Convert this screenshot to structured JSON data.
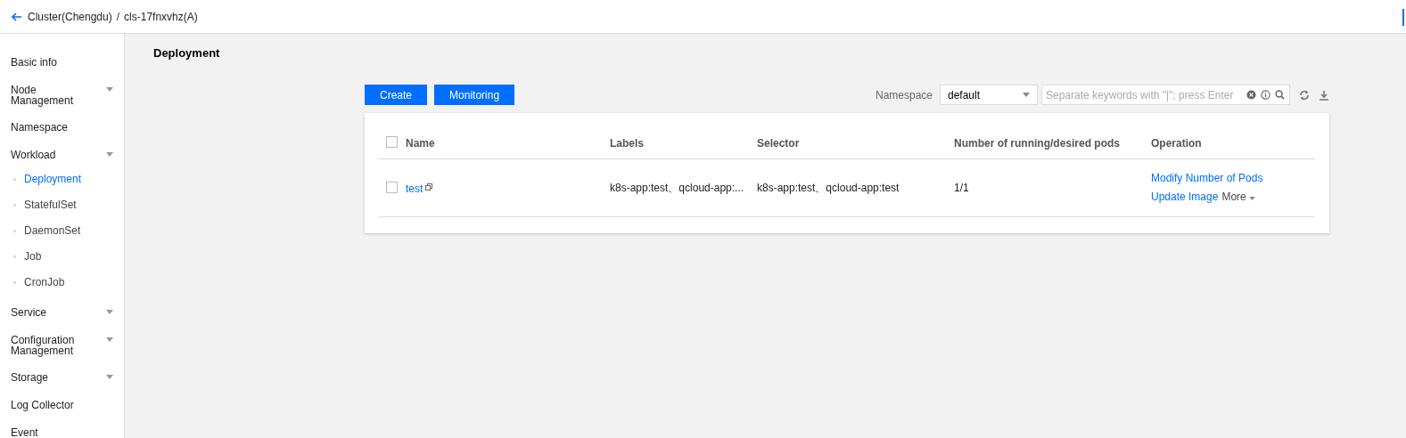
{
  "breadcrumb": {
    "parent": "Cluster(Chengdu)",
    "separator": "/",
    "current": "cls-17fnxvhz(A)"
  },
  "sidebar": {
    "items": [
      {
        "label": "Basic info",
        "kind": "link",
        "selected": false
      },
      {
        "label": "Node Management",
        "kind": "group",
        "selected": false
      },
      {
        "label": "Namespace",
        "kind": "link",
        "selected": false
      },
      {
        "label": "Workload",
        "kind": "group",
        "selected": false,
        "children": [
          {
            "label": "Deployment",
            "selected": true
          },
          {
            "label": "StatefulSet",
            "selected": false
          },
          {
            "label": "DaemonSet",
            "selected": false
          },
          {
            "label": "Job",
            "selected": false
          },
          {
            "label": "CronJob",
            "selected": false
          }
        ]
      },
      {
        "label": "Service",
        "kind": "group",
        "selected": false
      },
      {
        "label": "Configuration Management",
        "kind": "group",
        "selected": false
      },
      {
        "label": "Storage",
        "kind": "group",
        "selected": false
      },
      {
        "label": "Log Collector",
        "kind": "link",
        "selected": false
      },
      {
        "label": "Event",
        "kind": "link",
        "selected": false
      }
    ]
  },
  "page_title": "Deployment",
  "buttons": [
    "Create",
    "Monitoring"
  ],
  "namespace": {
    "label": "Namespace",
    "value": "default"
  },
  "search": {
    "placeholder": "Separate keywords with \"|\"; press Enter"
  },
  "table": {
    "columns": [
      "Name",
      "Labels",
      "Selector",
      "Number of running/desired pods",
      "Operation"
    ],
    "header_checked": false,
    "rows": [
      {
        "checked": false,
        "name": "test",
        "labels": "k8s-app:test、qcloud-app:...",
        "selector": "k8s-app:test、qcloud-app:test",
        "pods": "1/1",
        "actions": [
          "Modify Number of Pods",
          "Update Image"
        ],
        "more": "More"
      }
    ]
  }
}
